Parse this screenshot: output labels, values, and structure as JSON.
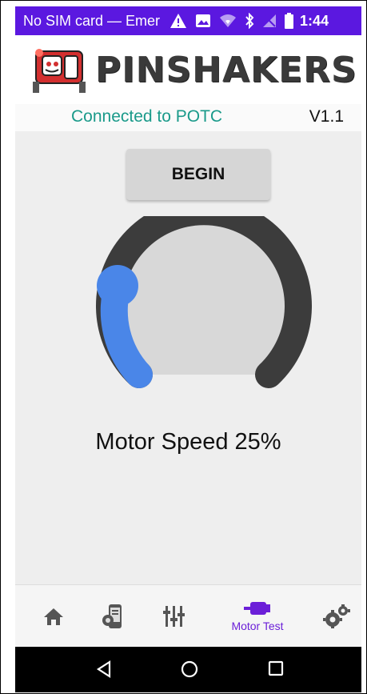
{
  "status_bar": {
    "carrier": "No SIM card — Emer",
    "time": "1:44",
    "background": "#5b18e0"
  },
  "header": {
    "logo_text": "PINSHAKERS",
    "connection_status": "Connected to POTC",
    "version": "V1.1"
  },
  "main": {
    "begin_label": "BEGIN",
    "motor_speed_label": "Motor Speed 25%",
    "motor_speed_percent": 25,
    "accent_color": "#4a86e8",
    "track_color": "#3c3c3c"
  },
  "bottom_nav": {
    "items": [
      {
        "icon": "home-icon",
        "label": ""
      },
      {
        "icon": "phone-settings-icon",
        "label": ""
      },
      {
        "icon": "sliders-icon",
        "label": ""
      },
      {
        "icon": "motor-icon",
        "label": "Motor Test",
        "active": true
      },
      {
        "icon": "gears-icon",
        "label": ""
      }
    ],
    "active_color": "#6b1fd8"
  },
  "system_nav": {
    "buttons": [
      "back-icon",
      "home-circle-icon",
      "recents-icon"
    ]
  }
}
